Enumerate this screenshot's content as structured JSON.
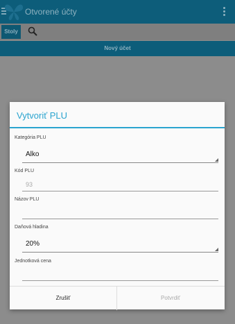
{
  "app": {
    "title": "Otvorené účty"
  },
  "tabs": {
    "active": "Stoly"
  },
  "main": {
    "new_account": "Nový účet"
  },
  "dialog": {
    "title": "Vytvoriť PLU",
    "category_label": "Kategória PLU",
    "category_value": "Alko",
    "code_label": "Kód PLU",
    "code_value": "93",
    "name_label": "Názov PLU",
    "name_value": "",
    "tax_label": "Daňová hladina",
    "tax_value": "20%",
    "unit_price_label": "Jednotková cena",
    "unit_price_value": "",
    "cancel": "Zrušiť",
    "confirm": "Potvrdiť"
  },
  "colors": {
    "accent": "#2aa4cf",
    "appbar": "#0d5d7a"
  }
}
